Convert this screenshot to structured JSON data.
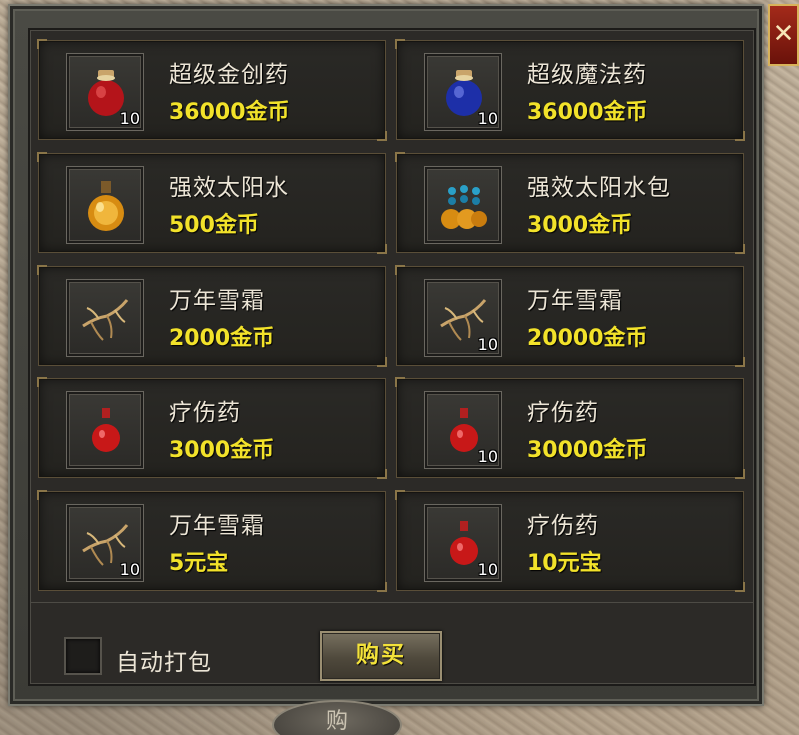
{
  "window": {
    "close_label": "✕",
    "auto_pack_label": "自动打包",
    "buy_label": "购买",
    "bottom_tab_label": "购"
  },
  "items": [
    {
      "name": "超级金创药",
      "price": "36000金币",
      "qty": "10",
      "icon": "red-potion-jar-icon"
    },
    {
      "name": "超级魔法药",
      "price": "36000金币",
      "qty": "10",
      "icon": "blue-potion-jar-icon"
    },
    {
      "name": "强效太阳水",
      "price": "500金币",
      "qty": "",
      "icon": "sun-water-flask-icon"
    },
    {
      "name": "强效太阳水包",
      "price": "3000金币",
      "qty": "",
      "icon": "sun-water-bundle-icon"
    },
    {
      "name": "万年雪霜",
      "price": "2000金币",
      "qty": "",
      "icon": "snow-frost-root-icon"
    },
    {
      "name": "万年雪霜",
      "price": "20000金币",
      "qty": "10",
      "icon": "snow-frost-root-icon"
    },
    {
      "name": "疗伤药",
      "price": "3000金币",
      "qty": "",
      "icon": "healing-potion-icon"
    },
    {
      "name": "疗伤药",
      "price": "30000金币",
      "qty": "10",
      "icon": "healing-potion-icon"
    },
    {
      "name": "万年雪霜",
      "price": "5元宝",
      "qty": "10",
      "icon": "snow-frost-root-icon"
    },
    {
      "name": "疗伤药",
      "price": "10元宝",
      "qty": "10",
      "icon": "healing-potion-icon"
    }
  ],
  "colors": {
    "price": "#f2e22a",
    "name": "#ece5d6",
    "panel": "#2c2a27"
  }
}
